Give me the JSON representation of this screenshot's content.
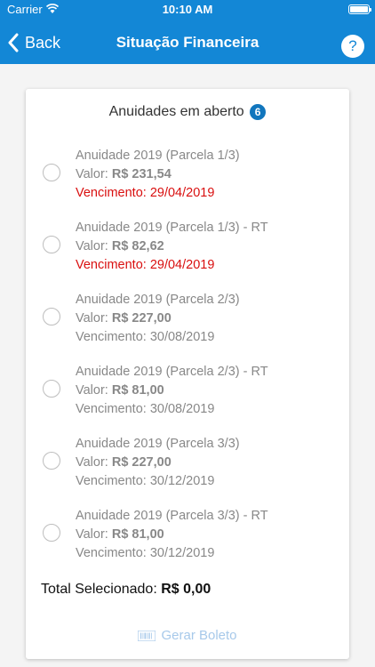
{
  "status_bar": {
    "carrier": "Carrier",
    "time": "10:10 AM"
  },
  "nav": {
    "back_label": "Back",
    "title": "Situação Financeira",
    "help_label": "?"
  },
  "card": {
    "header_title": "Anuidades em aberto",
    "badge_count": "6",
    "items": [
      {
        "title": "Anuidade 2019 (Parcela 1/3)",
        "value_prefix": "Valor: ",
        "value": "R$ 231,54",
        "due": "Vencimento: 29/04/2019",
        "overdue": true
      },
      {
        "title": "Anuidade 2019 (Parcela 1/3) - RT",
        "value_prefix": "Valor: ",
        "value": "R$ 82,62",
        "due": "Vencimento: 29/04/2019",
        "overdue": true
      },
      {
        "title": "Anuidade 2019 (Parcela 2/3)",
        "value_prefix": "Valor: ",
        "value": "R$ 227,00",
        "due": "Vencimento: 30/08/2019",
        "overdue": false
      },
      {
        "title": "Anuidade 2019 (Parcela 2/3) - RT",
        "value_prefix": "Valor: ",
        "value": "R$ 81,00",
        "due": "Vencimento: 30/08/2019",
        "overdue": false
      },
      {
        "title": "Anuidade 2019 (Parcela 3/3)",
        "value_prefix": "Valor: ",
        "value": "R$ 227,00",
        "due": "Vencimento: 30/12/2019",
        "overdue": false
      },
      {
        "title": "Anuidade 2019 (Parcela 3/3) - RT",
        "value_prefix": "Valor: ",
        "value": "R$ 81,00",
        "due": "Vencimento: 30/12/2019",
        "overdue": false
      }
    ],
    "total_label": "Total Selecionado: ",
    "total_value": "R$ 0,00",
    "generate_button": "Gerar Boleto",
    "generate_icon": "barcode-icon"
  },
  "colors": {
    "brand": "#1387d6",
    "badge": "#1176bd",
    "overdue": "#d90f0f",
    "disabled_button": "#a7c9ea"
  }
}
